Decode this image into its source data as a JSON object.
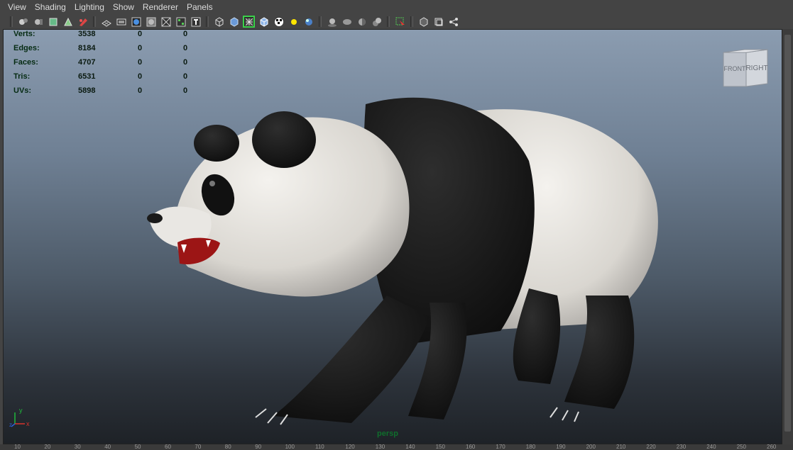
{
  "menu": [
    "View",
    "Shading",
    "Lighting",
    "Show",
    "Renderer",
    "Panels"
  ],
  "toolbar": {
    "groups": [
      [
        "camera-attributes-icon",
        "bookmarks-icon",
        "image-plane-icon",
        "2d-pan-zoom-icon",
        "grease-pencil-icon"
      ],
      [
        "grid-icon",
        "film-gate-icon",
        "resolution-gate-icon",
        "gate-mask-icon",
        "field-chart-icon",
        "safe-title-icon"
      ],
      [
        "wireframe-icon",
        "smooth-shade-icon",
        "wireframe-on-shaded-icon",
        "textured-icon",
        "use-default-lights-icon",
        "shadows-icon"
      ],
      [
        "ambient-occlusion-icon",
        "motion-blur-icon",
        "anti-aliasing-icon",
        "depth-of-field-icon"
      ],
      [
        "isolate-select-icon"
      ],
      [
        "xray-icon",
        "xray-joints-icon",
        "share-icon"
      ]
    ],
    "active": "wireframe-on-shaded-icon"
  },
  "hud": [
    {
      "label": "Verts:",
      "v1": "3538",
      "v2": "0",
      "v3": "0"
    },
    {
      "label": "Edges:",
      "v1": "8184",
      "v2": "0",
      "v3": "0"
    },
    {
      "label": "Faces:",
      "v1": "4707",
      "v2": "0",
      "v3": "0"
    },
    {
      "label": "Tris:",
      "v1": "6531",
      "v2": "0",
      "v3": "0"
    },
    {
      "label": "UVs:",
      "v1": "5898",
      "v2": "0",
      "v3": "0"
    }
  ],
  "viewcube": {
    "front": "FRONT",
    "right": "RIGHT"
  },
  "axis": {
    "x": "x",
    "y": "y",
    "z": "z"
  },
  "camera_label": "persp",
  "ruler": [
    "10",
    "20",
    "30",
    "40",
    "50",
    "60",
    "70",
    "80",
    "90",
    "100",
    "110",
    "120",
    "130",
    "140",
    "150",
    "160",
    "170",
    "180",
    "190",
    "200",
    "210",
    "220",
    "230",
    "240",
    "250",
    "260"
  ]
}
